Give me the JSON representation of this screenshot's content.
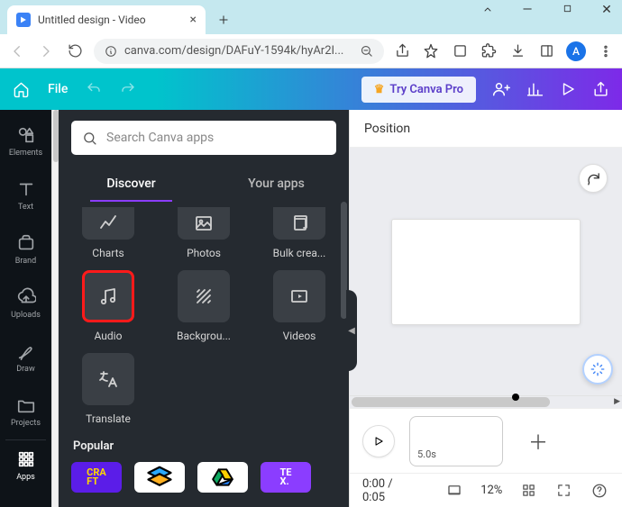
{
  "browser": {
    "tab_title": "Untitled design - Video",
    "url": "canva.com/design/DAFuY-1594k/hyAr2I...",
    "avatar_letter": "A"
  },
  "header": {
    "file_label": "File",
    "try_pro_label": "Try Canva Pro"
  },
  "sidebar": {
    "elements": "Elements",
    "text": "Text",
    "brand": "Brand",
    "uploads": "Uploads",
    "draw": "Draw",
    "projects": "Projects",
    "apps": "Apps"
  },
  "apps_panel": {
    "search_placeholder": "Search Canva apps",
    "tab_discover": "Discover",
    "tab_your_apps": "Your apps",
    "tiles": {
      "charts": "Charts",
      "photos": "Photos",
      "bulk_create": "Bulk crea...",
      "audio": "Audio",
      "background": "Backgrou...",
      "videos": "Videos",
      "translate": "Translate"
    },
    "popular_label": "Popular"
  },
  "canvas": {
    "position_label": "Position"
  },
  "timeline": {
    "clip_duration": "5.0s"
  },
  "bottombar": {
    "time": "0:00 / 0:05",
    "zoom": "12%"
  }
}
